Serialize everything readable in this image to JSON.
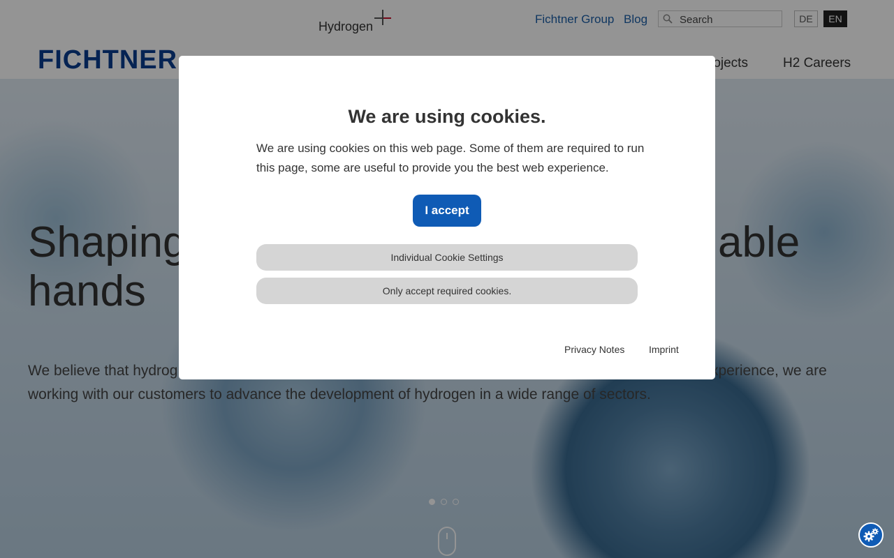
{
  "header": {
    "hydrogen_label": "Hydrogen",
    "brand_logo": "FICHTNER",
    "top_links": [
      "Fichtner Group",
      "Blog"
    ],
    "search": {
      "placeholder": "Search"
    },
    "languages": [
      "DE",
      "EN"
    ],
    "active_language": "EN",
    "nav": [
      "rojects",
      "H2 Careers"
    ]
  },
  "hero": {
    "title_line1": "Shaping",
    "title_line1_end": "able",
    "title_line2": "hands",
    "text_line1_start": "We believe that hydrog",
    "text_line1_end": "xperience, we are",
    "text_line2": "working with our customers to advance the development of hydrogen in a wide range of sectors.",
    "slide_count": 3,
    "active_slide": 1
  },
  "cookie_modal": {
    "title": "We are using cookies.",
    "text": "We are using cookies on this web page. Some of them are required to run this page, some are useful to provide you the best web experience.",
    "accept_label": "I accept",
    "settings_label": "Individual Cookie Settings",
    "required_label": "Only accept required cookies.",
    "privacy_link": "Privacy Notes",
    "imprint_link": "Imprint"
  },
  "colors": {
    "brand_blue": "#0a3d8f",
    "link_blue": "#1c5fa8",
    "accept_button": "#0f5bb5",
    "accent_red": "#c8102e"
  },
  "icons": [
    "search-icon",
    "cookie-settings-gear-icon",
    "scroll-mouse-icon"
  ]
}
